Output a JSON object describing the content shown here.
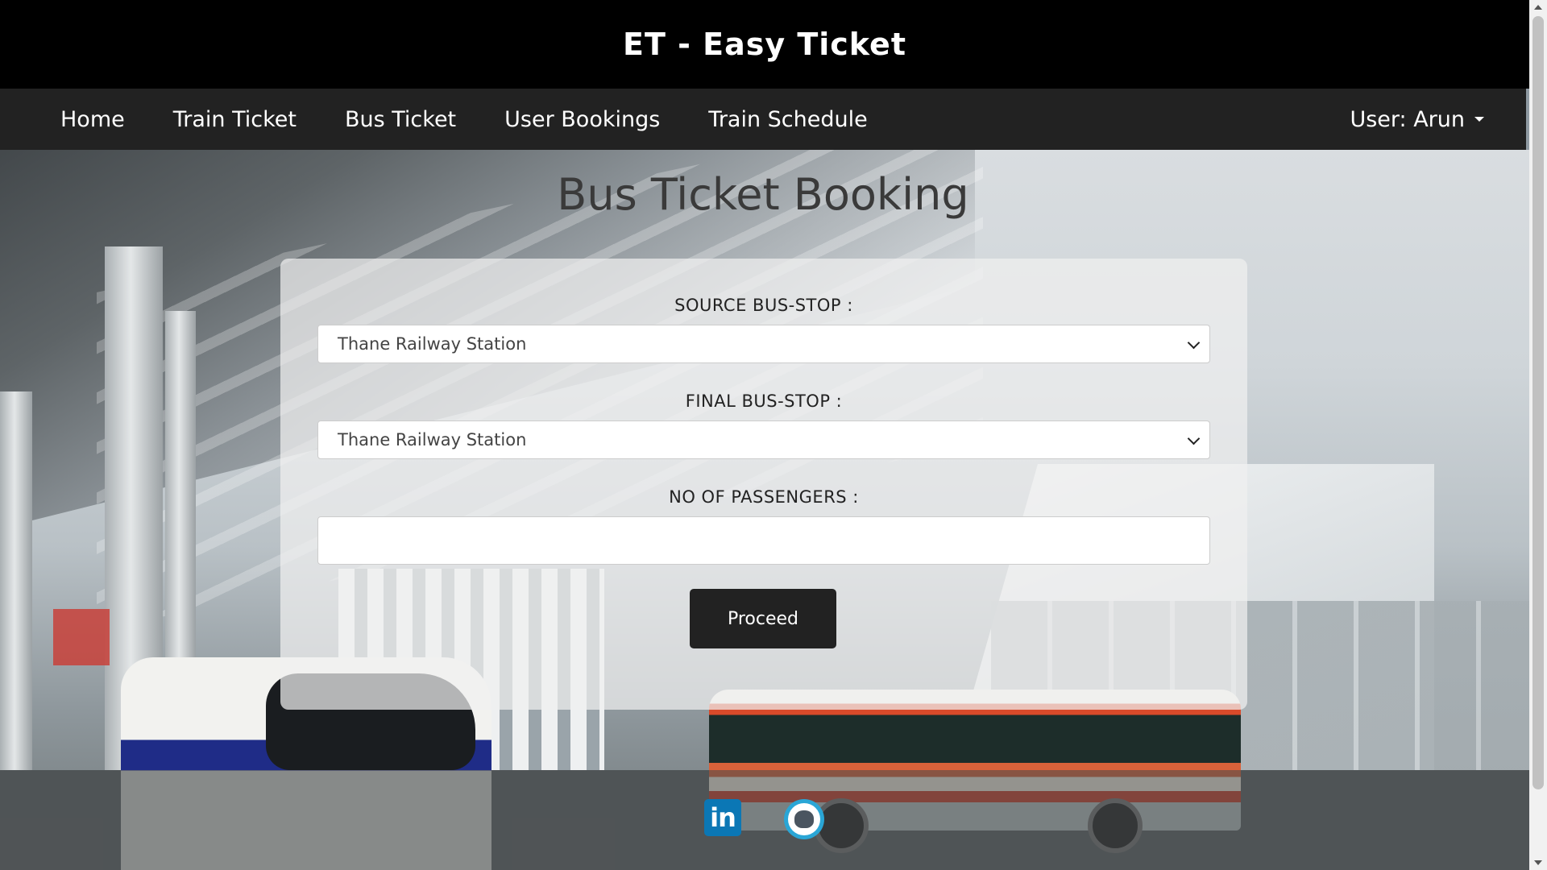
{
  "header": {
    "title": "ET - Easy Ticket"
  },
  "nav": {
    "items": [
      {
        "label": "Home"
      },
      {
        "label": "Train Ticket"
      },
      {
        "label": "Bus Ticket"
      },
      {
        "label": "User Bookings"
      },
      {
        "label": "Train Schedule"
      }
    ],
    "user": "User: Arun"
  },
  "main": {
    "title": "Bus Ticket Booking",
    "source_label": "SOURCE BUS-STOP :",
    "source_value": "Thane Railway Station",
    "final_label": "FINAL BUS-STOP :",
    "final_value": "Thane Railway Station",
    "passengers_label": "NO OF PASSENGERS :",
    "passengers_value": "",
    "proceed_label": "Proceed"
  },
  "footer": {
    "icons": [
      "linkedin-icon",
      "github-icon"
    ],
    "linkedin_text": "in"
  }
}
